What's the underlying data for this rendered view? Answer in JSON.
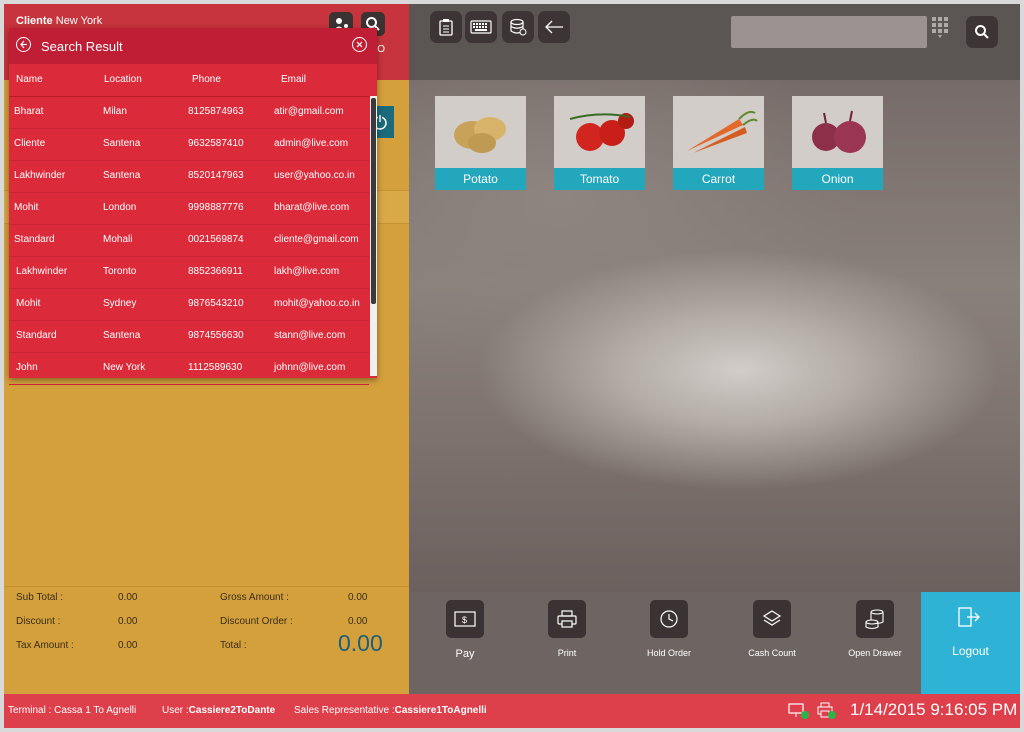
{
  "client": {
    "label": "Cliente",
    "value": "New York"
  },
  "header": {
    "no_label": "NO"
  },
  "search_popup": {
    "title": "Search Result",
    "columns": [
      "Name",
      "Location",
      "Phone",
      "Email"
    ],
    "rows": [
      {
        "name": "Bharat",
        "location": "Milan",
        "phone": "8125874963",
        "email": "atir@gmail.com"
      },
      {
        "name": "Cliente",
        "location": "Santena",
        "phone": "9632587410",
        "email": "admin@live.com"
      },
      {
        "name": "Lakhwinder",
        "location": "Santena",
        "phone": "8520147963",
        "email": "user@yahoo.co.in"
      },
      {
        "name": "Mohit",
        "location": "London",
        "phone": "9998887776",
        "email": "bharat@live.com"
      },
      {
        "name": "Standard",
        "location": "Mohali",
        "phone": "0021569874",
        "email": "cliente@gmail.com"
      },
      {
        "name": "Lakhwinder",
        "location": "Toronto",
        "phone": "8852366911",
        "email": "lakh@live.com"
      },
      {
        "name": "Mohit",
        "location": "Sydney",
        "phone": "9876543210",
        "email": "mohit@yahoo.co.in"
      },
      {
        "name": "Standard",
        "location": "Santena",
        "phone": "9874556630",
        "email": "stann@live.com"
      },
      {
        "name": "John",
        "location": "New York",
        "phone": "1112589630",
        "email": "johnn@live.com"
      }
    ]
  },
  "totals": {
    "sub_total_label": "Sub Total :",
    "sub_total": "0.00",
    "discount_label": "Discount :",
    "discount": "0.00",
    "tax_label": "Tax Amount :",
    "tax": "0.00",
    "gross_label": "Gross Amount :",
    "gross": "0.00",
    "discount_order_label": "Discount Order :",
    "discount_order": "0.00",
    "total_label": "Total :",
    "total": "0.00"
  },
  "products": [
    {
      "name": "Potato",
      "icon": "potato-image"
    },
    {
      "name": "Tomato",
      "icon": "tomato-image"
    },
    {
      "name": "Carrot",
      "icon": "carrot-image"
    },
    {
      "name": "Onion",
      "icon": "onion-image"
    }
  ],
  "actions": {
    "pay": "Pay",
    "print": "Print",
    "hold_order": "Hold Order",
    "cash_count": "Cash Count",
    "open_drawer": "Open Drawer",
    "logout": "Logout"
  },
  "status": {
    "terminal_label": "Terminal :",
    "terminal": "Cassa 1 To Agnelli",
    "user_label": "User :",
    "user": "Cassiere2ToDante",
    "rep_label": "Sales Representative :",
    "rep": "Cassiere1ToAgnelli",
    "datetime": "1/14/2015 9:16:05 PM"
  },
  "colors": {
    "accent_red": "#dd3f4b",
    "teal": "#22a7bd",
    "left_panel": "#d4a03c",
    "logout": "#2eb3d7"
  }
}
